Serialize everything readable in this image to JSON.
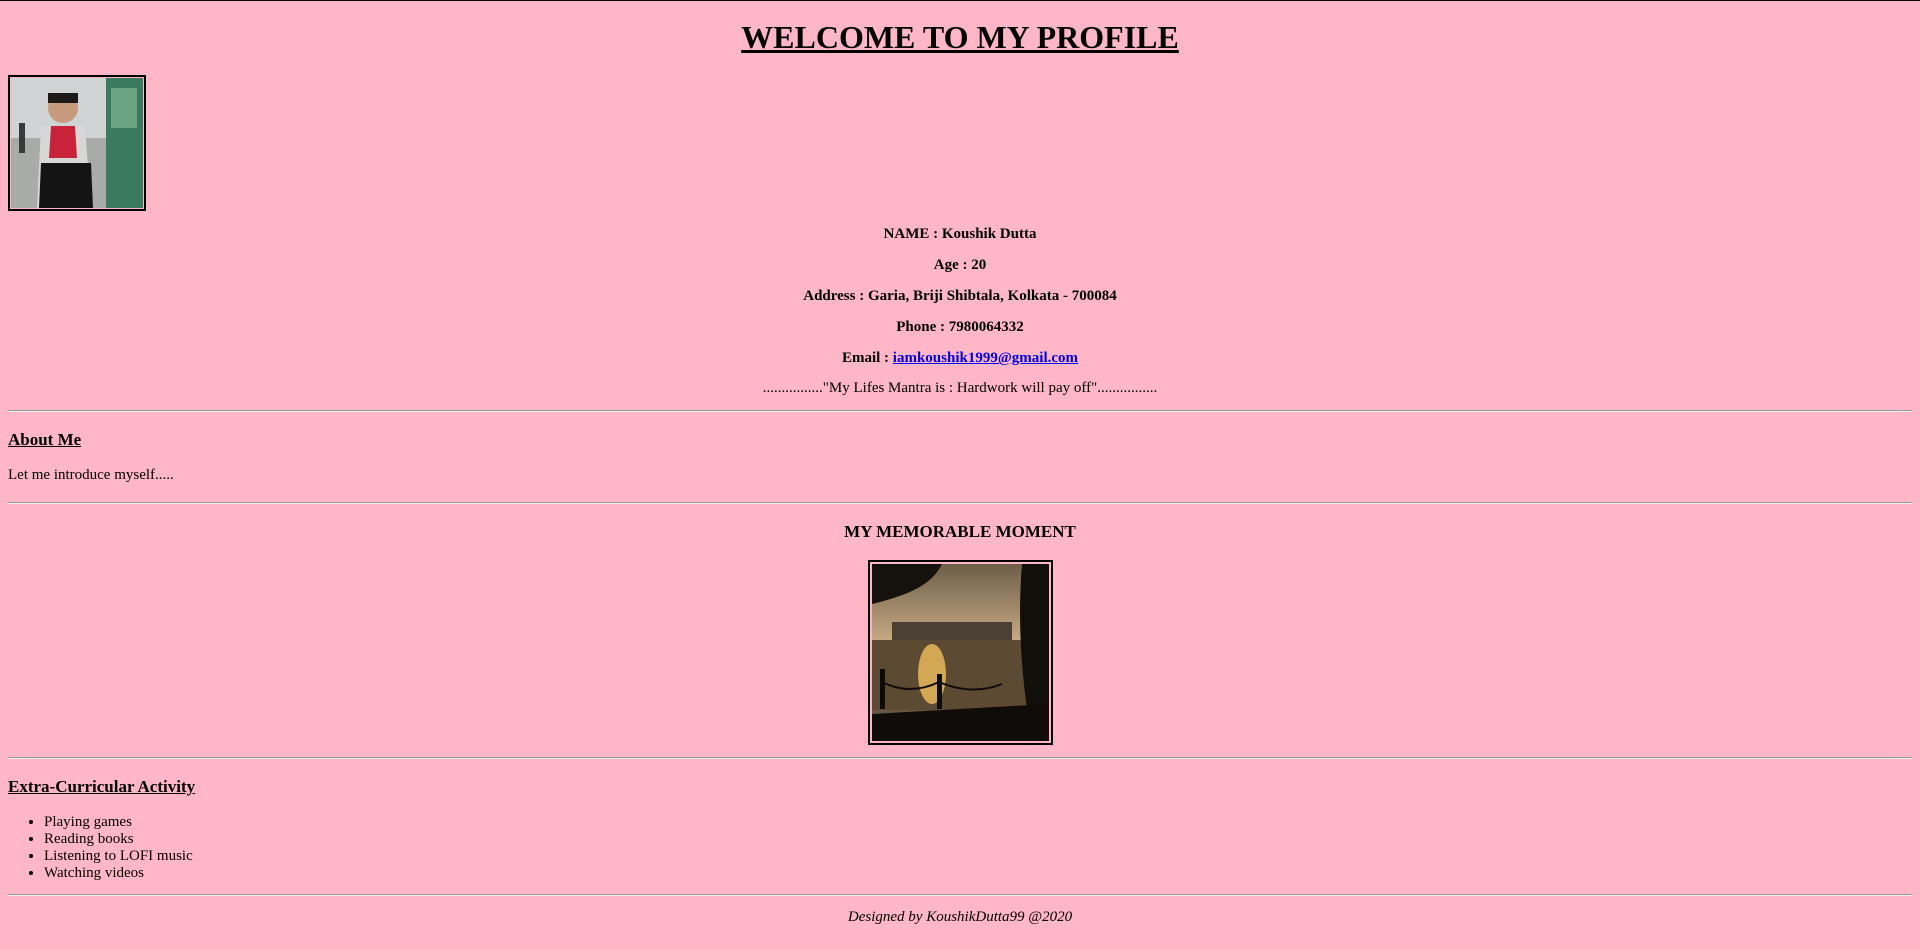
{
  "title": "WELCOME TO MY PROFILE",
  "profile": {
    "name": "NAME : Koushik Dutta",
    "age": "Age : 20",
    "address": "Address : Garia, Briji Shibtala, Kolkata - 700084",
    "phone": "Phone : 7980064332",
    "email_label": "Email : ",
    "email": "iamkoushik1999@gmail.com",
    "mantra": "................\"My Lifes Mantra is : Hardwork will pay off\"................"
  },
  "about": {
    "heading": "About Me",
    "text": "Let me introduce myself....."
  },
  "moment": {
    "heading": "MY MEMORABLE MOMENT"
  },
  "activities": {
    "heading": "Extra-Curricular Activity",
    "items": [
      "Playing games",
      "Reading books",
      "Listening to LOFI music",
      "Watching videos"
    ]
  },
  "footer": "Designed by KoushikDutta99 @2020"
}
